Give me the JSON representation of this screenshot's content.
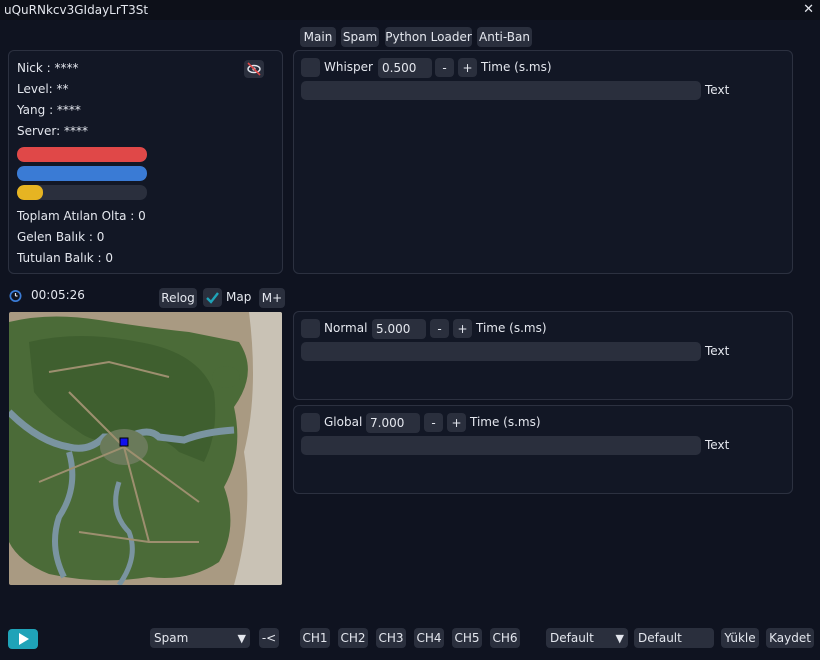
{
  "window": {
    "title": "uQuRNkcv3GIdayLrT3St",
    "close_label": "✕"
  },
  "tabs": [
    "Main",
    "Spam",
    "Python Loader",
    "Anti-Ban"
  ],
  "info": {
    "nick": "Nick : ****",
    "level": "Level: **",
    "yang": "Yang : ****",
    "server": "Server: ****",
    "hp_fraction": 1.0,
    "mp_fraction": 1.0,
    "exp_fraction": 0.2,
    "total_casts": "Toplam Atılan Olta : 0",
    "fish_arrived": "Gelen Balık : 0",
    "fish_caught": "Tutulan Balık : 0"
  },
  "timer": {
    "value": "00:05:26"
  },
  "map_controls": {
    "relog": "Relog",
    "map_label": "Map",
    "map_checked": true,
    "mplus": "M+"
  },
  "spam_rows": {
    "whisper": {
      "label": "Whisper",
      "value": "0.500",
      "minus": "-",
      "plus": "+",
      "unit": "Time (s.ms)",
      "text_label": "Text"
    },
    "normal": {
      "label": "Normal",
      "value": "5.000",
      "minus": "-",
      "plus": "+",
      "unit": "Time (s.ms)",
      "text_label": "Text"
    },
    "global": {
      "label": "Global",
      "value": "7.000",
      "minus": "-",
      "plus": "+",
      "unit": "Time (s.ms)",
      "text_label": "Text"
    }
  },
  "bottom": {
    "mode_select": "Spam",
    "back": "-<",
    "channels": [
      "CH1",
      "CH2",
      "CH3",
      "CH4",
      "CH5",
      "CH6"
    ],
    "profile_select": "Default",
    "profile_name": "Default",
    "load": "Yükle",
    "save": "Kaydet"
  },
  "colors": {
    "hp": "#e04848",
    "mp": "#3a7bd5",
    "exp": "#e6b422",
    "accent": "#1fa3b8"
  }
}
